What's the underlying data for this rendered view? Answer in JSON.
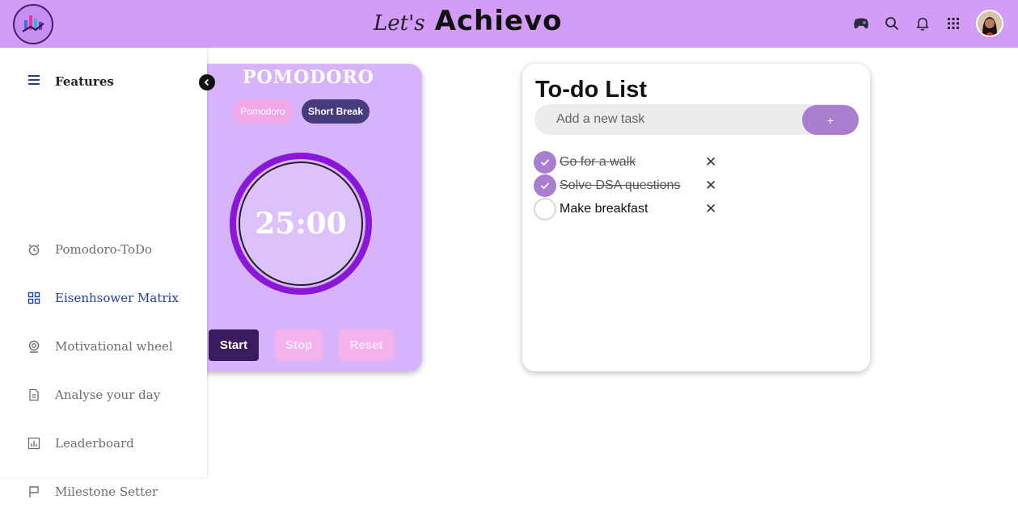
{
  "header": {
    "brand_script": "Let's",
    "brand_name": "Achievo"
  },
  "sidebar": {
    "heading": "Features",
    "items": [
      {
        "label": "Pomodoro-ToDo",
        "icon": "alarm-clock-icon"
      },
      {
        "label": "Eisenhsower Matrix",
        "icon": "grid-icon"
      },
      {
        "label": "Motivational wheel",
        "icon": "webcam-icon"
      },
      {
        "label": "Analyse your day",
        "icon": "document-icon"
      },
      {
        "label": "Leaderboard",
        "icon": "bar-chart-icon"
      },
      {
        "label": "Milestone Setter",
        "icon": "flag-icon"
      }
    ],
    "active_index": 1
  },
  "pomodoro": {
    "title": "POMODORO",
    "mode_pomodoro": "Pomodoro",
    "mode_short_break": "Short Break",
    "time": "25:00",
    "start_label": "Start",
    "stop_label": "Stop",
    "reset_label": "Reset"
  },
  "todo": {
    "title": "To-do List",
    "placeholder": "Add a new task",
    "add_label": "+",
    "tasks": [
      {
        "text": "Go for a walk",
        "done": true
      },
      {
        "text": "Solve DSA questions",
        "done": true
      },
      {
        "text": "Make breakfast",
        "done": false
      }
    ],
    "remove_symbol": "✕"
  },
  "colors": {
    "header_bg": "#d29cf7",
    "pomo_card": "#d7b3fb",
    "ring": "#8a16d8",
    "accent": "#a97ed0",
    "active_nav": "#1f3fa6",
    "start_button": "#3a1c5e"
  }
}
